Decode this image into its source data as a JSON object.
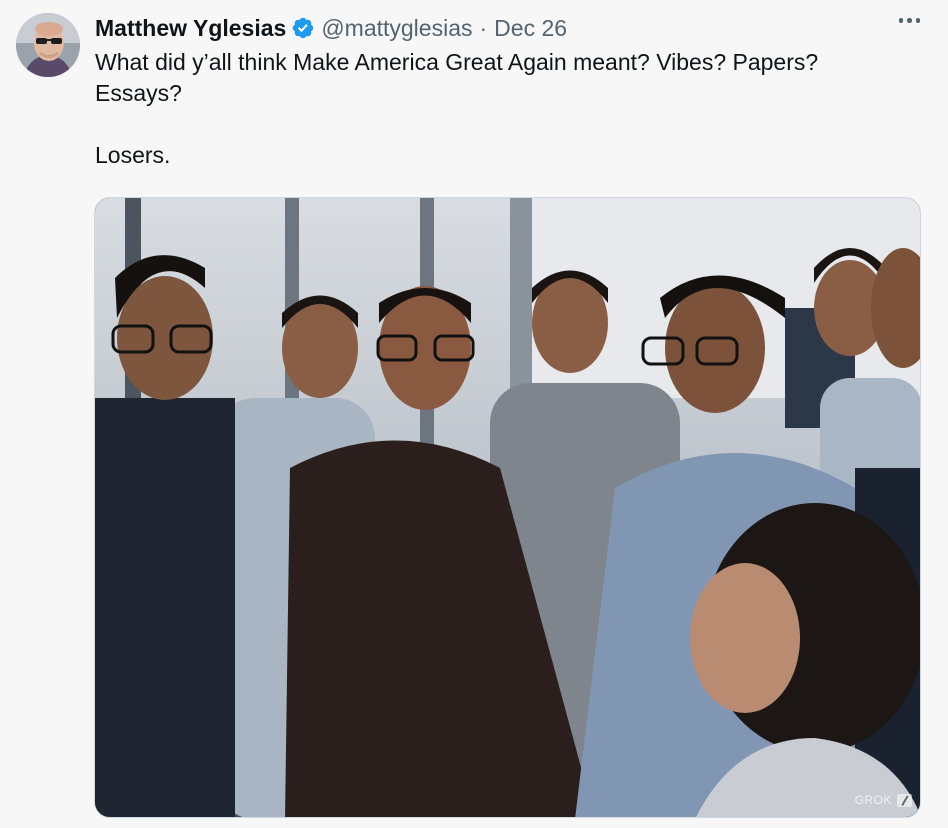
{
  "tweet": {
    "author_name": "Matthew Yglesias",
    "handle": "@mattyglesias",
    "separator": "·",
    "date": "Dec 26",
    "text_line1": "What did y’all think Make America Great Again meant? Vibes? Papers? Essays?",
    "text_line2": "Losers.",
    "verified_color": "#1d9bf0"
  },
  "media": {
    "watermark": "GROK",
    "description_icon": "grok-logo-icon"
  },
  "icons": [
    "avatar",
    "verified-badge-icon",
    "more-options-icon",
    "grok-logo-icon"
  ]
}
